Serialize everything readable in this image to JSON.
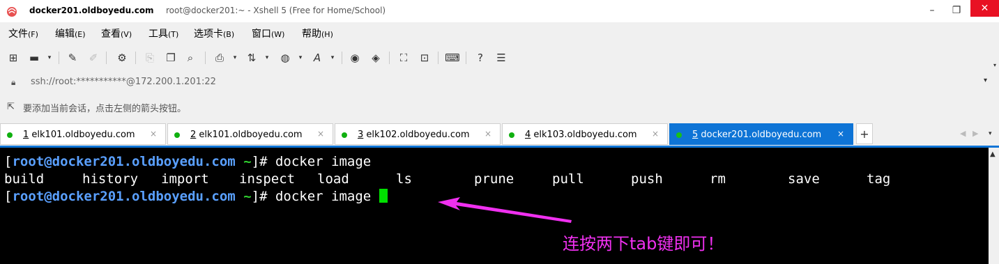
{
  "window": {
    "host_title": "docker201.oldboyedu.com",
    "subtitle": "root@docker201:~ - Xshell 5 (Free for Home/School)",
    "minimize": "–",
    "maximize": "❐",
    "close": "✕"
  },
  "menu": [
    {
      "label": "文件",
      "key": "(F)"
    },
    {
      "label": "编辑",
      "key": "(E)"
    },
    {
      "label": "查看",
      "key": "(V)"
    },
    {
      "label": "工具",
      "key": "(T)"
    },
    {
      "label": "选项卡",
      "key": "(B)"
    },
    {
      "label": "窗口",
      "key": "(W)"
    },
    {
      "label": "帮助",
      "key": "(H)"
    }
  ],
  "address": {
    "text": "ssh://root:***********@172.200.1.201:22"
  },
  "hint": {
    "text": "要添加当前会话，点击左侧的箭头按钮。"
  },
  "tabs": [
    {
      "num": "1",
      "label": " elk101.oldboyedu.com",
      "active": false
    },
    {
      "num": "2",
      "label": " elk101.oldboyedu.com",
      "active": false
    },
    {
      "num": "3",
      "label": " elk102.oldboyedu.com",
      "active": false
    },
    {
      "num": "4",
      "label": " elk103.oldboyedu.com",
      "active": false
    },
    {
      "num": "5",
      "label": " docker201.oldboyedu.com",
      "active": true
    }
  ],
  "tab_close": "×",
  "tab_add": "+",
  "terminal": {
    "prompt_open": "[",
    "prompt_user": "root@docker201.oldboyedu.com",
    "prompt_dir": " ~",
    "prompt_close": "]# ",
    "command": "docker image",
    "completions": [
      "build",
      "history",
      "import",
      "inspect",
      "load",
      "ls",
      "prune",
      "pull",
      "push",
      "rm",
      "save",
      "tag"
    ]
  },
  "annotation": {
    "text": "连按两下tab键即可！",
    "color": "#f030f0"
  },
  "colors": {
    "accent": "#0e74d6",
    "prompt_user": "#5aa0ff",
    "prompt_host": "#2fd12f",
    "status_dot": "#10b010",
    "cursor": "#00e000"
  }
}
